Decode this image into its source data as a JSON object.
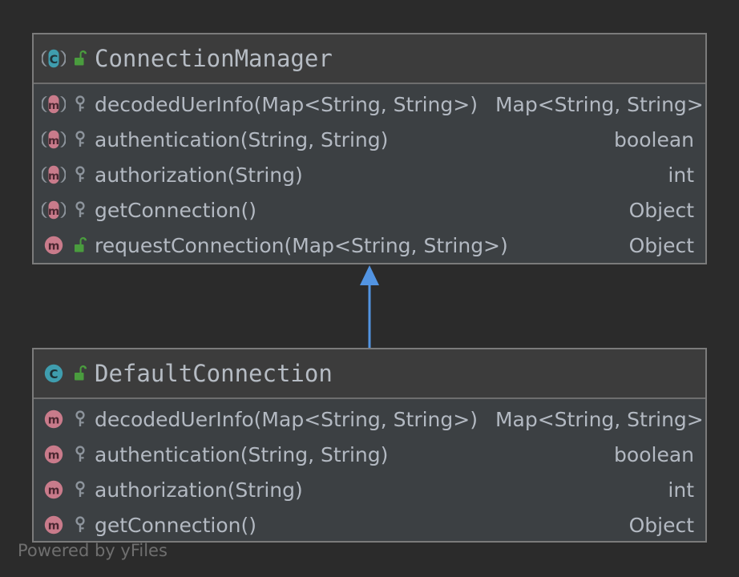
{
  "diagram": {
    "type": "uml-class-diagram",
    "background_color": "#2b2b2b",
    "watermark": "Powered by yFiles",
    "edges": [
      {
        "name": "inheritance-edge",
        "kind": "generalization",
        "from": "DefaultConnection",
        "to": "ConnectionManager",
        "color": "#5294e2",
        "arrowhead": "filled-triangle"
      }
    ]
  },
  "classes": [
    {
      "id": "connection-manager",
      "name": "ConnectionManager",
      "kind_icon": "abstract-class-icon",
      "visibility_icon": "unlocked-public-icon",
      "members": [
        {
          "kind_icon": "abstract-method-icon",
          "visibility_icon": "key-protected-icon",
          "name": "decodedUerInfo(Map<String, String>)",
          "type": "Map<String, String>"
        },
        {
          "kind_icon": "abstract-method-icon",
          "visibility_icon": "key-protected-icon",
          "name": "authentication(String, String)",
          "type": "boolean"
        },
        {
          "kind_icon": "abstract-method-icon",
          "visibility_icon": "key-protected-icon",
          "name": "authorization(String)",
          "type": "int"
        },
        {
          "kind_icon": "abstract-method-icon",
          "visibility_icon": "key-protected-icon",
          "name": "getConnection()",
          "type": "Object"
        },
        {
          "kind_icon": "method-icon",
          "visibility_icon": "unlocked-public-icon",
          "name": "requestConnection(Map<String, String>)",
          "type": "Object"
        }
      ]
    },
    {
      "id": "default-connection",
      "name": "DefaultConnection",
      "kind_icon": "class-icon",
      "visibility_icon": "unlocked-public-icon",
      "members": [
        {
          "kind_icon": "method-icon",
          "visibility_icon": "key-protected-icon",
          "name": "decodedUerInfo(Map<String, String>)",
          "type": "Map<String, String>"
        },
        {
          "kind_icon": "method-icon",
          "visibility_icon": "key-protected-icon",
          "name": "authentication(String, String)",
          "type": "boolean"
        },
        {
          "kind_icon": "method-icon",
          "visibility_icon": "key-protected-icon",
          "name": "authorization(String)",
          "type": "int"
        },
        {
          "kind_icon": "method-icon",
          "visibility_icon": "key-protected-icon",
          "name": "getConnection()",
          "type": "Object"
        }
      ]
    }
  ],
  "colors": {
    "class_icon": "#3f9dae",
    "method_icon": "#c97b8b",
    "lock_open": "#4a9c3e",
    "key": "#8d949c",
    "edge": "#5294e2",
    "node_border": "#7b7b7b",
    "node_body": "#3c4043",
    "node_header": "#3c3c3c",
    "text": "#b3b9c2",
    "title_text": "#b6bcc4",
    "watermark_text": "#6f6f6f"
  }
}
